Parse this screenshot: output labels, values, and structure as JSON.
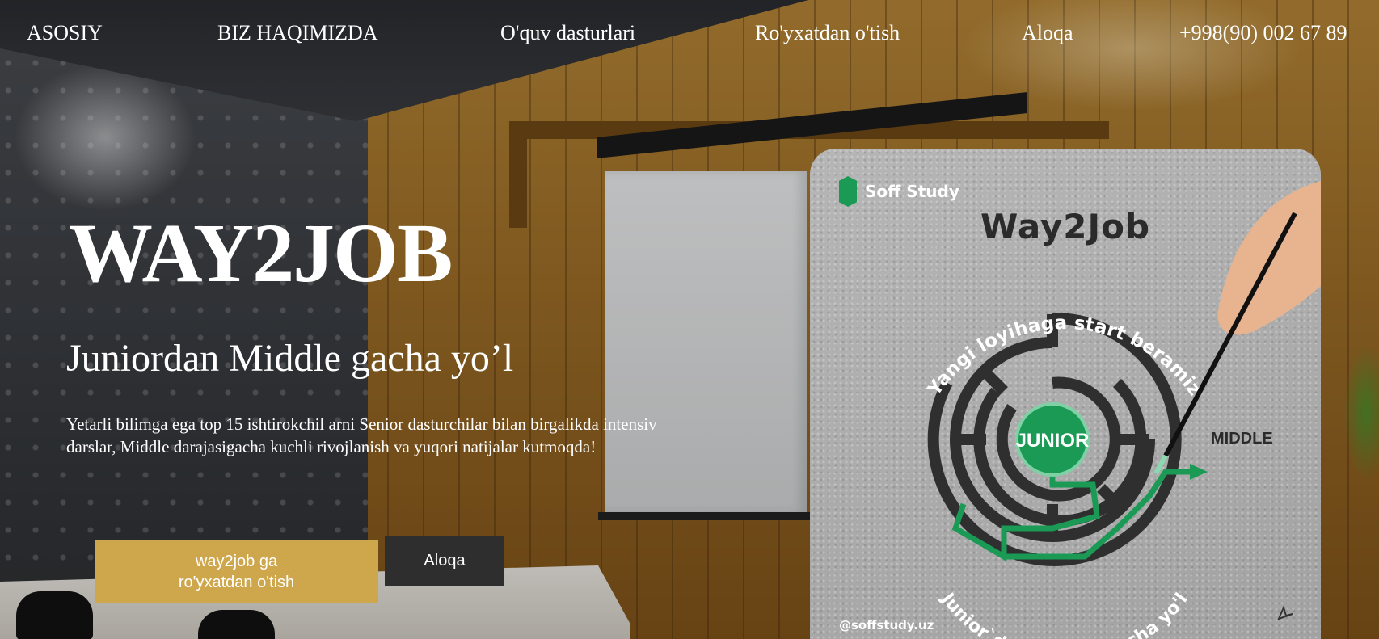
{
  "nav": {
    "items": [
      {
        "label": "ASOSIY"
      },
      {
        "label": "BIZ HAQIMIZDA"
      },
      {
        "label": "O'quv dasturlari"
      },
      {
        "label": "Ro'yxatdan o'tish"
      },
      {
        "label": "Aloqa"
      }
    ],
    "phone": "+998(90) 002 67 89"
  },
  "hero": {
    "title": "WAY2JOB",
    "subtitle": "Juniordan Middle gacha yo’l",
    "description": "Yetarli bilimga ega top 15 ishtirokchil arni Senior dasturchilar bilan birgalikda intensiv darslar, Middle darajasigacha kuchli rivojlanish va yuqori natijalar kutmoqda!",
    "primary_button": "way2job ga\nro'yxatdan o'tish",
    "secondary_button": "Aloqa"
  },
  "poster": {
    "brand": "Soff Study",
    "title": "Way2Job",
    "arc_top": "Yangi loyihaga start beramiz",
    "arc_bottom": "Junior`dan Middle`gacha yo'l",
    "center_label": "JUNIOR",
    "exit_label": "MIDDLE",
    "handle": "@soffstudy.uz",
    "accent_color": "#1a9a55",
    "button_color": "#cea64c"
  }
}
